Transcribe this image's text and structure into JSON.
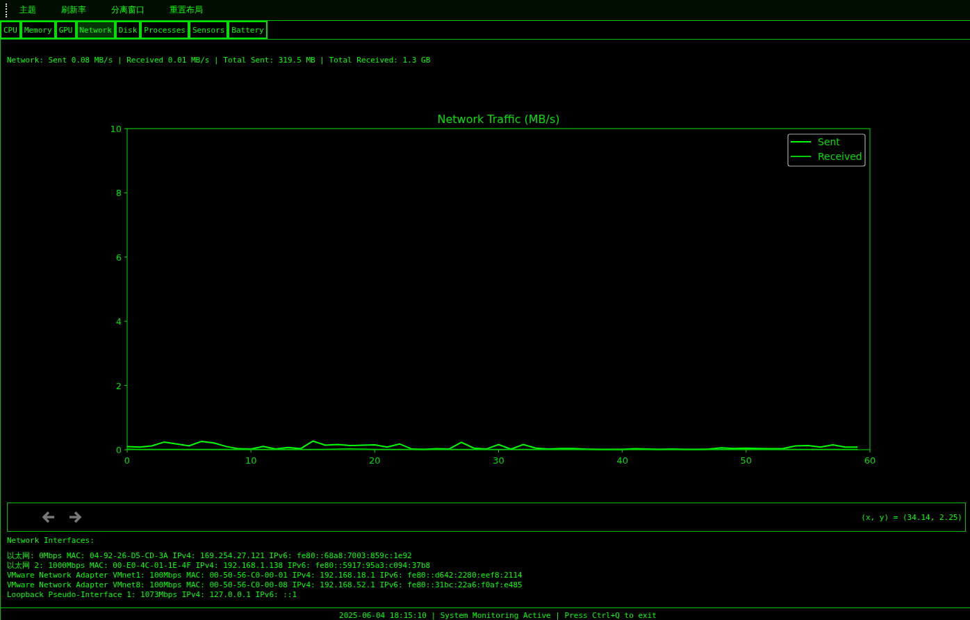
{
  "menu": [
    "主题",
    "刷新率",
    "分离窗口",
    "重置布局"
  ],
  "tabs": [
    {
      "label": "CPU",
      "selected": false
    },
    {
      "label": "Memory",
      "selected": false
    },
    {
      "label": "GPU",
      "selected": false
    },
    {
      "label": "Network",
      "selected": true
    },
    {
      "label": "Disk",
      "selected": false
    },
    {
      "label": "Processes",
      "selected": false
    },
    {
      "label": "Sensors",
      "selected": false
    },
    {
      "label": "Battery",
      "selected": false
    }
  ],
  "summary": "Network: Sent 0.08 MB/s | Received 0.01 MB/s | Total Sent: 319.5 MB | Total Received: 1.3 GB",
  "chart_data": {
    "type": "line",
    "title": "Network Traffic (MB/s)",
    "legend": true,
    "xlim": [
      0,
      60
    ],
    "ylim": [
      0,
      10
    ],
    "xticks": [
      0,
      10,
      20,
      30,
      40,
      50,
      60
    ],
    "yticks": [
      0,
      2,
      4,
      6,
      8,
      10
    ],
    "x": [
      0,
      1,
      2,
      3,
      4,
      5,
      6,
      7,
      8,
      9,
      10,
      11,
      12,
      13,
      14,
      15,
      16,
      17,
      18,
      19,
      20,
      21,
      22,
      23,
      24,
      25,
      26,
      27,
      28,
      29,
      30,
      31,
      32,
      33,
      34,
      35,
      36,
      37,
      38,
      39,
      40,
      41,
      42,
      43,
      44,
      45,
      46,
      47,
      48,
      49,
      50,
      51,
      52,
      53,
      54,
      55,
      56,
      57,
      58,
      59
    ],
    "series": [
      {
        "name": "Sent",
        "color": "#00ff00",
        "values": [
          0.1,
          0.08,
          0.12,
          0.24,
          0.18,
          0.12,
          0.26,
          0.21,
          0.1,
          0.03,
          0.02,
          0.1,
          0.02,
          0.07,
          0.03,
          0.27,
          0.14,
          0.16,
          0.13,
          0.14,
          0.15,
          0.08,
          0.18,
          0.02,
          0.01,
          0.03,
          0.02,
          0.23,
          0.05,
          0.02,
          0.16,
          0.02,
          0.16,
          0.05,
          0.02,
          0.04,
          0.04,
          0.02,
          0.01,
          0.01,
          0.01,
          0.03,
          0.02,
          0.01,
          0.02,
          0.01,
          0.01,
          0.02,
          0.06,
          0.04,
          0.05,
          0.04,
          0.03,
          0.04,
          0.12,
          0.13,
          0.08,
          0.15,
          0.08,
          0.08
        ]
      },
      {
        "name": "Received",
        "color": "#00cc00",
        "values": [
          0.02,
          0.01,
          0.01,
          0.01,
          0.01,
          0.01,
          0.01,
          0.01,
          0.01,
          0.01,
          0.01,
          0.01,
          0.01,
          0.01,
          0.01,
          0.01,
          0.01,
          0.02,
          0.03,
          0.02,
          0.01,
          0.01,
          0.01,
          0.01,
          0.01,
          0.01,
          0.01,
          0.01,
          0.01,
          0.01,
          0.01,
          0.01,
          0.01,
          0.01,
          0.01,
          0.01,
          0.01,
          0.01,
          0.01,
          0.01,
          0.01,
          0.01,
          0.01,
          0.01,
          0.01,
          0.01,
          0.01,
          0.01,
          0.01,
          0.01,
          0.01,
          0.01,
          0.01,
          0.01,
          0.01,
          0.01,
          0.01,
          0.01,
          0.01,
          0.01
        ]
      }
    ]
  },
  "toolbar": {
    "coords": "(x, y) = (34.14, 2.25)"
  },
  "interfaces_title": "Network Interfaces:",
  "interfaces": [
    "以太网: 0Mbps MAC: 04-92-26-D5-CD-3A IPv4: 169.254.27.121 IPv6: fe80::68a8:7003:859c:1e92",
    "以太网 2: 1000Mbps MAC: 00-E0-4C-01-1E-4F IPv4: 192.168.1.138 IPv6: fe80::5917:95a3:c094:37b8",
    "VMware Network Adapter VMnet1: 100Mbps MAC: 00-50-56-C0-00-01 IPv4: 192.168.18.1 IPv6: fe80::d642:2280:eef8:2114",
    "VMware Network Adapter VMnet8: 100Mbps MAC: 00-50-56-C0-00-08 IPv4: 192.168.52.1 IPv6: fe80::31bc:22a6:f0af:e485",
    "Loopback Pseudo-Interface 1: 1073Mbps IPv4: 127.0.0.1 IPv6: ::1"
  ],
  "status_bar": "2025-06-04 18:15:10 | System Monitoring Active | Press Ctrl+Q to exit"
}
